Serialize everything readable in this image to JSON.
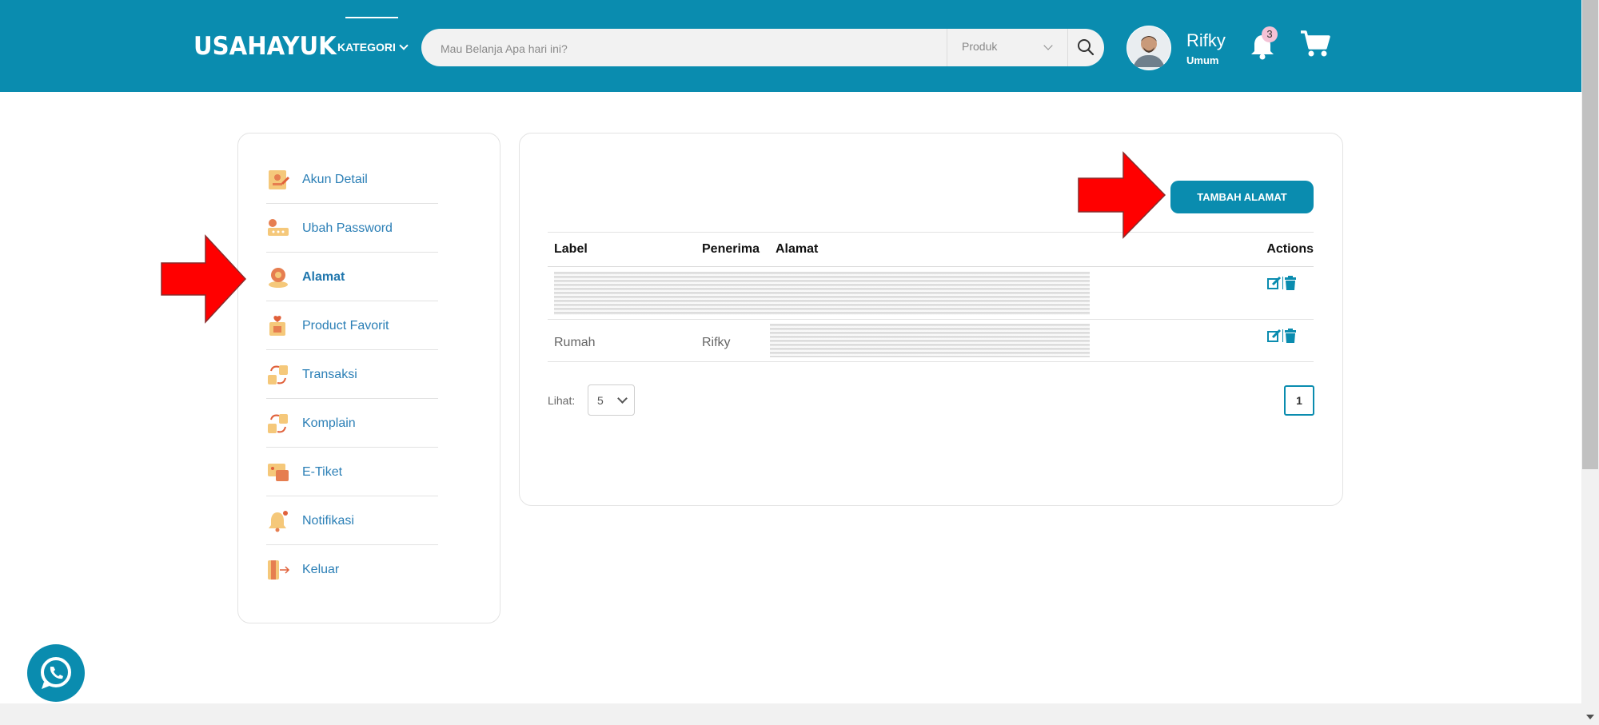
{
  "header": {
    "logo": "USAHAYUK",
    "kategori_label": "KATEGORI",
    "search_placeholder": "Mau Belanja Apa hari ini?",
    "search_type": "Produk",
    "user_name": "Rifky",
    "user_role": "Umum",
    "notification_count": "3",
    "colors": {
      "primary": "#0a8caf",
      "badge": "#f4c2d6"
    }
  },
  "sidebar": {
    "items": [
      {
        "label": "Akun Detail",
        "icon": "user-detail-icon"
      },
      {
        "label": "Ubah Password",
        "icon": "password-key-icon"
      },
      {
        "label": "Alamat",
        "icon": "address-location-icon",
        "active": true
      },
      {
        "label": "Product Favorit",
        "icon": "favorite-product-icon"
      },
      {
        "label": "Transaksi",
        "icon": "transaction-icon"
      },
      {
        "label": "Komplain",
        "icon": "complaint-icon"
      },
      {
        "label": "E-Tiket",
        "icon": "ticket-icon"
      },
      {
        "label": "Notifikasi",
        "icon": "notification-bell-icon"
      },
      {
        "label": "Keluar",
        "icon": "logout-icon"
      }
    ]
  },
  "main": {
    "add_button_label": "TAMBAH ALAMAT",
    "table": {
      "columns": [
        "Label",
        "Penerima",
        "Alamat",
        "Actions"
      ],
      "rows": [
        {
          "label": "",
          "penerima": "",
          "alamat": ""
        },
        {
          "label": "Rumah",
          "penerima": "Rifky",
          "alamat": ""
        }
      ]
    },
    "pagination": {
      "lihat_label": "Lihat:",
      "per_page": "5",
      "current_page": "1"
    }
  }
}
